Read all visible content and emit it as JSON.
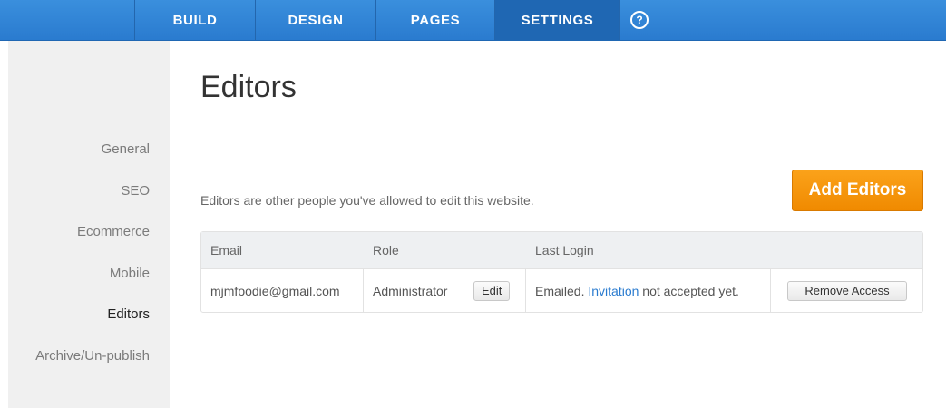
{
  "nav": {
    "tabs": [
      {
        "label": "BUILD"
      },
      {
        "label": "DESIGN"
      },
      {
        "label": "PAGES"
      },
      {
        "label": "SETTINGS",
        "active": true
      }
    ],
    "help_glyph": "?"
  },
  "sidebar": {
    "items": [
      {
        "label": "General"
      },
      {
        "label": "SEO"
      },
      {
        "label": "Ecommerce"
      },
      {
        "label": "Mobile"
      },
      {
        "label": "Editors",
        "active": true
      },
      {
        "label": "Archive/Un-publish"
      }
    ]
  },
  "main": {
    "title": "Editors",
    "description": "Editors are other people you've allowed to edit this website.",
    "add_button": "Add Editors",
    "table": {
      "headers": [
        "Email",
        "Role",
        "Last Login"
      ],
      "rows": [
        {
          "email": "mjmfoodie@gmail.com",
          "role": "Administrator",
          "edit_label": "Edit",
          "last_login_prefix": "Emailed.",
          "last_login_link": "Invitation",
          "last_login_suffix": "not accepted yet.",
          "remove_label": "Remove Access"
        }
      ]
    }
  },
  "colors": {
    "nav_bg": "#2a7bcf",
    "accent_orange": "#f08a00",
    "link_blue": "#2a7bcf"
  },
  "icons": {
    "help": "help-circle-icon"
  }
}
